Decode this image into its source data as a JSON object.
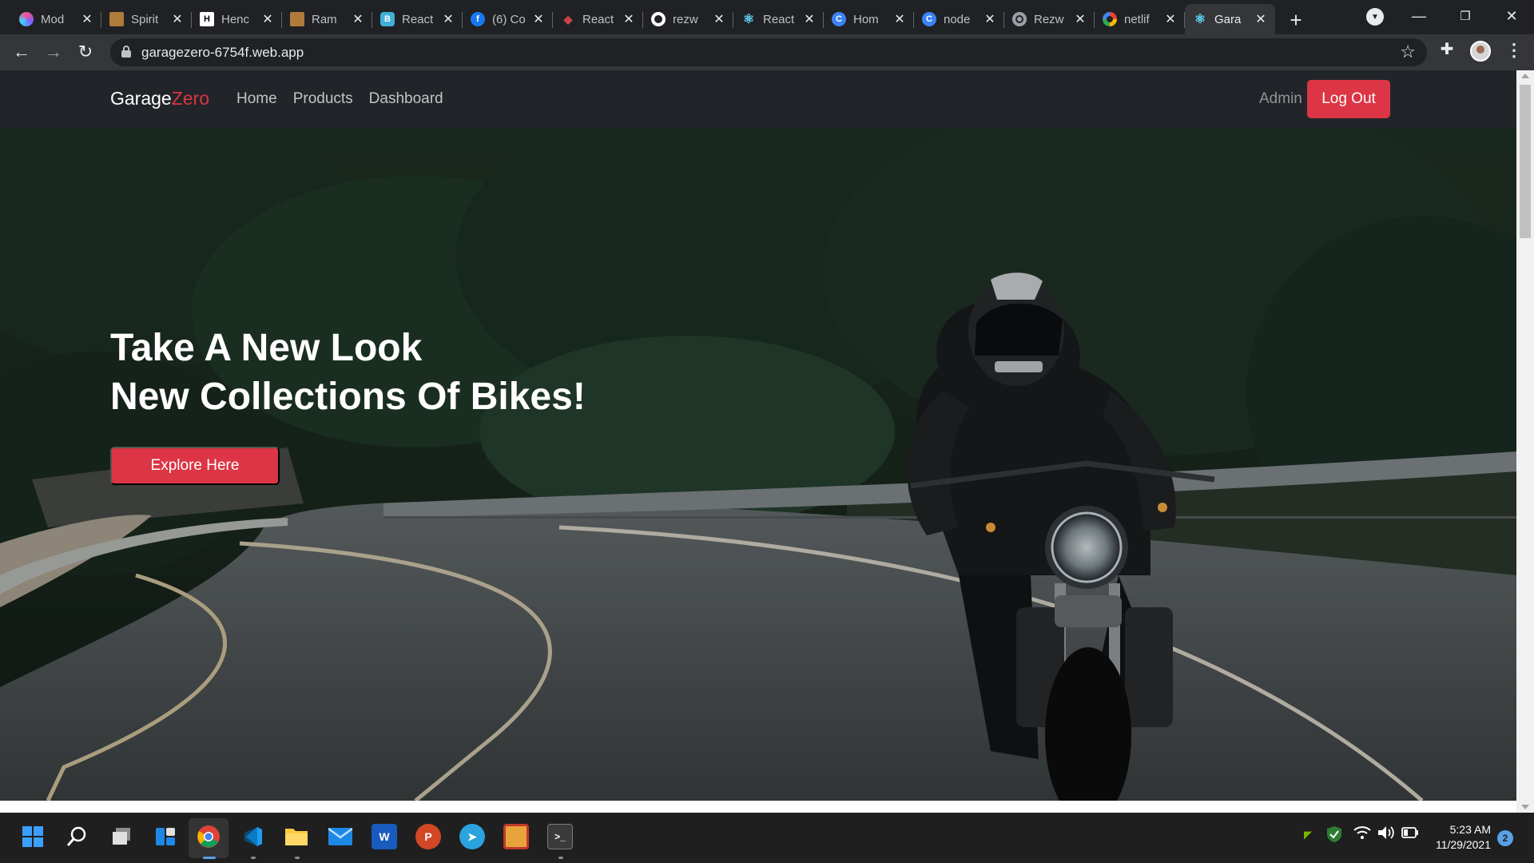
{
  "browser": {
    "tabs": [
      {
        "label": "Mod",
        "icon": "colorful-app-icon",
        "color": "#7b61ff"
      },
      {
        "label": "Spirit",
        "icon": "book-icon",
        "color": "#b07a3b"
      },
      {
        "label": "Henc",
        "icon": "h-logo-icon",
        "color": "#ffffff"
      },
      {
        "label": "Ram",
        "icon": "book-icon",
        "color": "#b07a3b"
      },
      {
        "label": "React",
        "icon": "bootstrap-react-icon",
        "color": "#3fb0d7"
      },
      {
        "label": "(6) Co",
        "icon": "facebook-icon",
        "color": "#1877f2"
      },
      {
        "label": "React",
        "icon": "react-router-icon",
        "color": "#ca4245"
      },
      {
        "label": "rezw",
        "icon": "github-icon",
        "color": "#ffffff"
      },
      {
        "label": "React",
        "icon": "react-icon",
        "color": "#61dafb"
      },
      {
        "label": "Hom",
        "icon": "c-logo-icon",
        "color": "#3b82f6"
      },
      {
        "label": "node",
        "icon": "c-logo-icon",
        "color": "#3b82f6"
      },
      {
        "label": "Rezw",
        "icon": "globe-icon",
        "color": "#9aa0a6"
      },
      {
        "label": "netlif",
        "icon": "google-icon",
        "color": "#ffffff"
      },
      {
        "label": "Gara",
        "icon": "react-icon",
        "color": "#61dafb"
      }
    ],
    "active_tab_index": 13,
    "url": "garagezero-6754f.web.app"
  },
  "site": {
    "brand_main": "Garage",
    "brand_accent": "Zero",
    "nav": [
      "Home",
      "Products",
      "Dashboard"
    ],
    "admin_label": "Admin",
    "logout_label": "Log Out",
    "hero_line1": "Take A New Look",
    "hero_line2": "New Collections Of Bikes!",
    "cta_label": "Explore Here",
    "accent_color": "#dc3545"
  },
  "taskbar": {
    "apps": [
      "windows-start-icon",
      "search-icon",
      "task-view-icon",
      "widgets-icon",
      "chrome-icon",
      "vscode-icon",
      "file-explorer-icon",
      "mail-icon",
      "word-icon",
      "powerpoint-icon",
      "telegram-icon",
      "media-app-icon",
      "terminal-icon"
    ],
    "time": "5:23 AM",
    "date": "11/29/2021",
    "notifications": "2"
  }
}
